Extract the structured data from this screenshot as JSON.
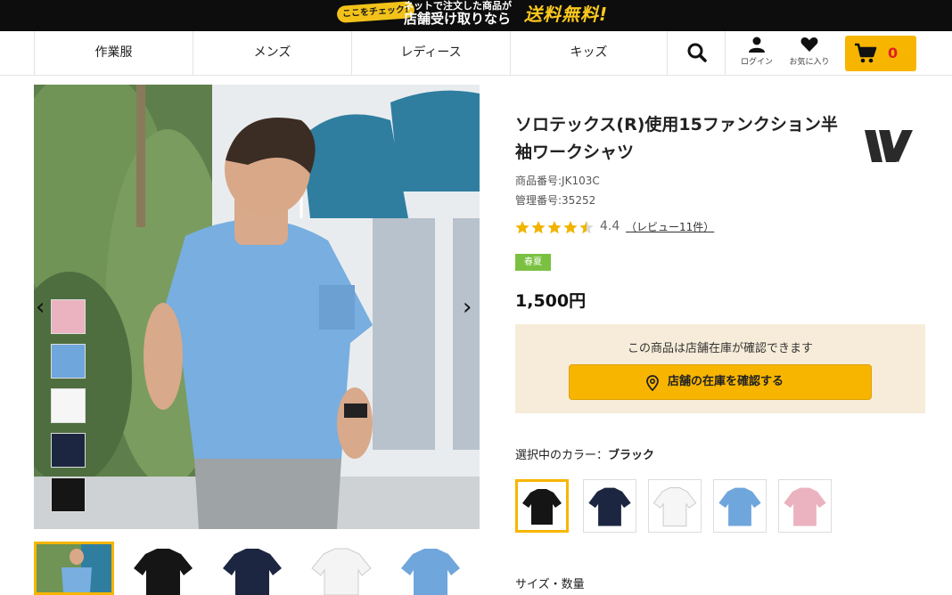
{
  "banner": {
    "badge": "ここをチェック!",
    "line1": "ネットで注文した商品が",
    "line2": "店舗受け取りなら",
    "highlight": "送料無料!"
  },
  "nav": {
    "categories": [
      "作業服",
      "メンズ",
      "レディース",
      "キッズ"
    ],
    "login": "ログイン",
    "favorites": "お気に入り",
    "cart_count": "0"
  },
  "product": {
    "title": "ソロテックス(R)使用15ファンクション半袖ワークシャツ",
    "item_number": "商品番号:JK103C",
    "management_number": "管理番号:35252",
    "rating": "4.4",
    "rating_value": 4.4,
    "review_link": "（レビュー11件）",
    "season": "春夏",
    "price": "1,500円"
  },
  "stock": {
    "message": "この商品は店舗在庫が確認できます",
    "button": "店舗の在庫を確認する"
  },
  "colors": {
    "label_prefix": "選択中のカラー：",
    "selected": "ブラック",
    "options": [
      {
        "name": "ブラック",
        "hex": "#151515"
      },
      {
        "name": "ネイビー",
        "hex": "#1c2640"
      },
      {
        "name": "ホワイト",
        "hex": "#f6f6f6"
      },
      {
        "name": "サックス",
        "hex": "#6fa6dc"
      },
      {
        "name": "ピンク",
        "hex": "#eab3bf"
      }
    ]
  },
  "size_label": "サイズ・数量",
  "palette": {
    "accent": "#f8b500",
    "price_red": "#e02020",
    "season_green": "#7ac142"
  }
}
